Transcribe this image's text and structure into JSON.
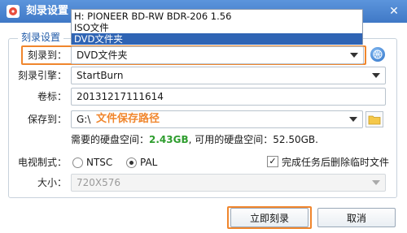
{
  "window": {
    "title": "刻录设置",
    "close": "✕"
  },
  "group": {
    "legend": "刻录设置"
  },
  "dropdown_options": [
    "H: PIONEER BD-RW   BDR-206 1.56",
    "ISO文件",
    "DVD文件夹"
  ],
  "burn_to": {
    "label": "刻录到：",
    "value": "DVD文件夹"
  },
  "engine": {
    "label": "刻录引擎：",
    "value": "StartBurn"
  },
  "volume": {
    "label": "卷标：",
    "value": "20131217111614"
  },
  "save_to": {
    "label": "保存到：",
    "drive": "G:\\",
    "hint": "文件保存路径"
  },
  "space": {
    "prefix": "需要的硬盘空间：",
    "required": "2.43GB",
    "middle": ", 可用的硬盘空间：",
    "available": "52.50GB."
  },
  "tv": {
    "label": "电视制式：",
    "ntsc": "NTSC",
    "pal": "PAL",
    "selected": "PAL"
  },
  "delete_temp": {
    "label": "完成任务后删除临时文件",
    "checked": true,
    "mark": "✓"
  },
  "size": {
    "label": "大小：",
    "value": "720X576"
  },
  "buttons": {
    "burn_now": "立即刻录",
    "cancel": "取消"
  },
  "colors": {
    "accent": "#f0862d",
    "highlight_text": "#f0862d",
    "green": "#2e9d2e",
    "title_bar": "#4a85d1"
  },
  "icons": {
    "help": "help-globe-icon",
    "folder": "folder-icon",
    "app": "disc-icon"
  }
}
